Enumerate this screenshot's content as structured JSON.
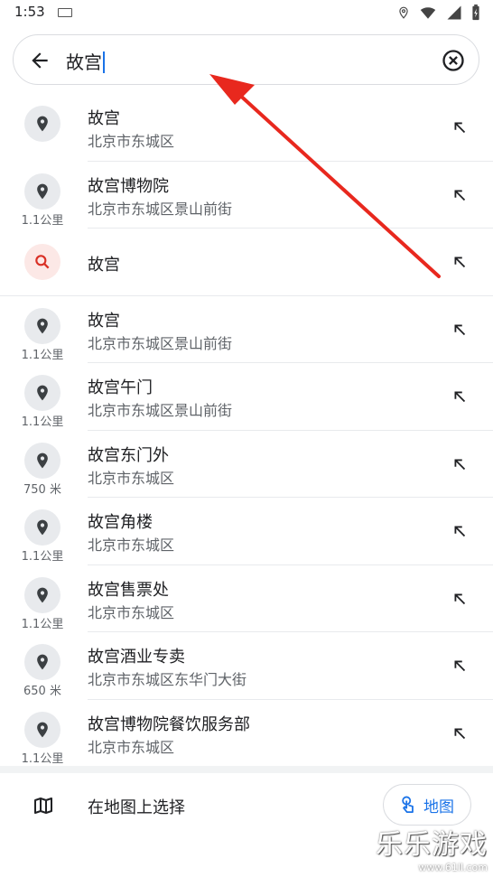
{
  "status_bar": {
    "time": "1:53"
  },
  "search": {
    "query": "故宫"
  },
  "results": [
    {
      "kind": "place",
      "distance": "",
      "title": "故宫",
      "subtitle": "北京市东城区"
    },
    {
      "kind": "place",
      "distance": "1.1公里",
      "title": "故宫博物院",
      "subtitle": "北京市东城区景山前街"
    },
    {
      "kind": "query",
      "distance": "",
      "title": "故宫",
      "subtitle": ""
    },
    {
      "kind": "place",
      "distance": "1.1公里",
      "title": "故宫",
      "subtitle": "北京市东城区景山前街"
    },
    {
      "kind": "place",
      "distance": "1.1公里",
      "title": "故宫午门",
      "subtitle": "北京市东城区景山前街"
    },
    {
      "kind": "place",
      "distance": "750 米",
      "title": "故宫东门外",
      "subtitle": "北京市东城区"
    },
    {
      "kind": "place",
      "distance": "1.1公里",
      "title": "故宫角楼",
      "subtitle": "北京市东城区"
    },
    {
      "kind": "place",
      "distance": "1.1公里",
      "title": "故宫售票处",
      "subtitle": "北京市东城区"
    },
    {
      "kind": "place",
      "distance": "650 米",
      "title": "故宫酒业专卖",
      "subtitle": "北京市东城区东华门大街"
    },
    {
      "kind": "place",
      "distance": "1.1公里",
      "title": "故宫博物院餐饮服务部",
      "subtitle": "北京市东城区"
    }
  ],
  "map_select": {
    "label": "在地图上选择",
    "chip_label": "地图"
  },
  "watermark": {
    "main": "乐乐游戏",
    "sub": "www.61ll.com"
  },
  "colors": {
    "accent": "#1a73e8",
    "annotation_arrow": "#e8281e",
    "search_icon": "#d93025"
  }
}
